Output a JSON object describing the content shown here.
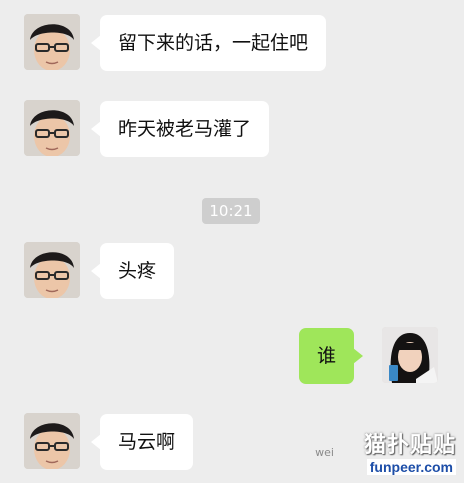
{
  "messages": [
    {
      "side": "in",
      "text": "留下来的话，一起住吧",
      "avatar": "boy-glasses-avatar"
    },
    {
      "side": "in",
      "text": "昨天被老马灌了",
      "avatar": "boy-glasses-avatar"
    },
    {
      "side": "in",
      "text": "头疼",
      "avatar": "boy-glasses-avatar"
    },
    {
      "side": "out",
      "text": "谁",
      "avatar": "girl-avatar"
    },
    {
      "side": "in",
      "text": "马云啊",
      "avatar": "boy-glasses-avatar"
    }
  ],
  "timestamp": "10:21",
  "watermark": {
    "logo_text": "猫扑贴贴",
    "weibo_prefix": "wei",
    "url": "funpeer.com"
  },
  "colors": {
    "background": "#ededed",
    "incoming_bubble": "#ffffff",
    "outgoing_bubble": "#9fe65a",
    "timestamp_bg": "#cecece"
  }
}
